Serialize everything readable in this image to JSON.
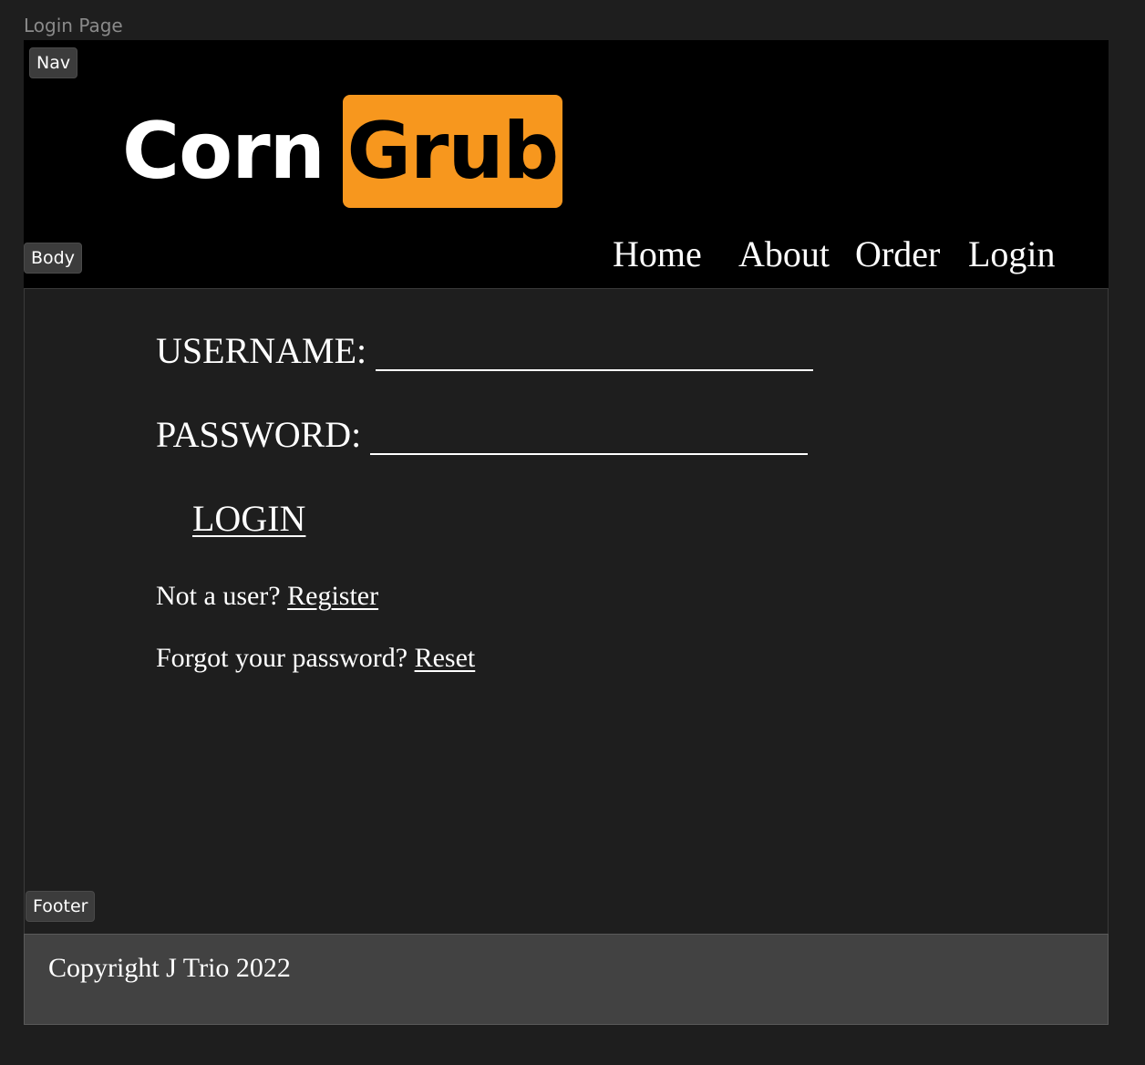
{
  "frame_label": "Login Page",
  "section_tags": {
    "nav": "Nav",
    "body": "Body",
    "footer": "Footer"
  },
  "logo": {
    "part1": "Corn",
    "part2": "Grub",
    "accent_color": "#f7971e"
  },
  "nav": {
    "links": [
      "Home",
      "About",
      "Order",
      "Login"
    ]
  },
  "form": {
    "username_label": "USERNAME:",
    "username_value": "",
    "password_label": "PASSWORD:",
    "password_value": "",
    "login_label": "LOGIN",
    "register_prompt": "Not a user?",
    "register_link": "Register",
    "reset_prompt": "Forgot your password?",
    "reset_link": "Reset"
  },
  "footer": {
    "copyright": "Copyright J Trio 2022"
  }
}
